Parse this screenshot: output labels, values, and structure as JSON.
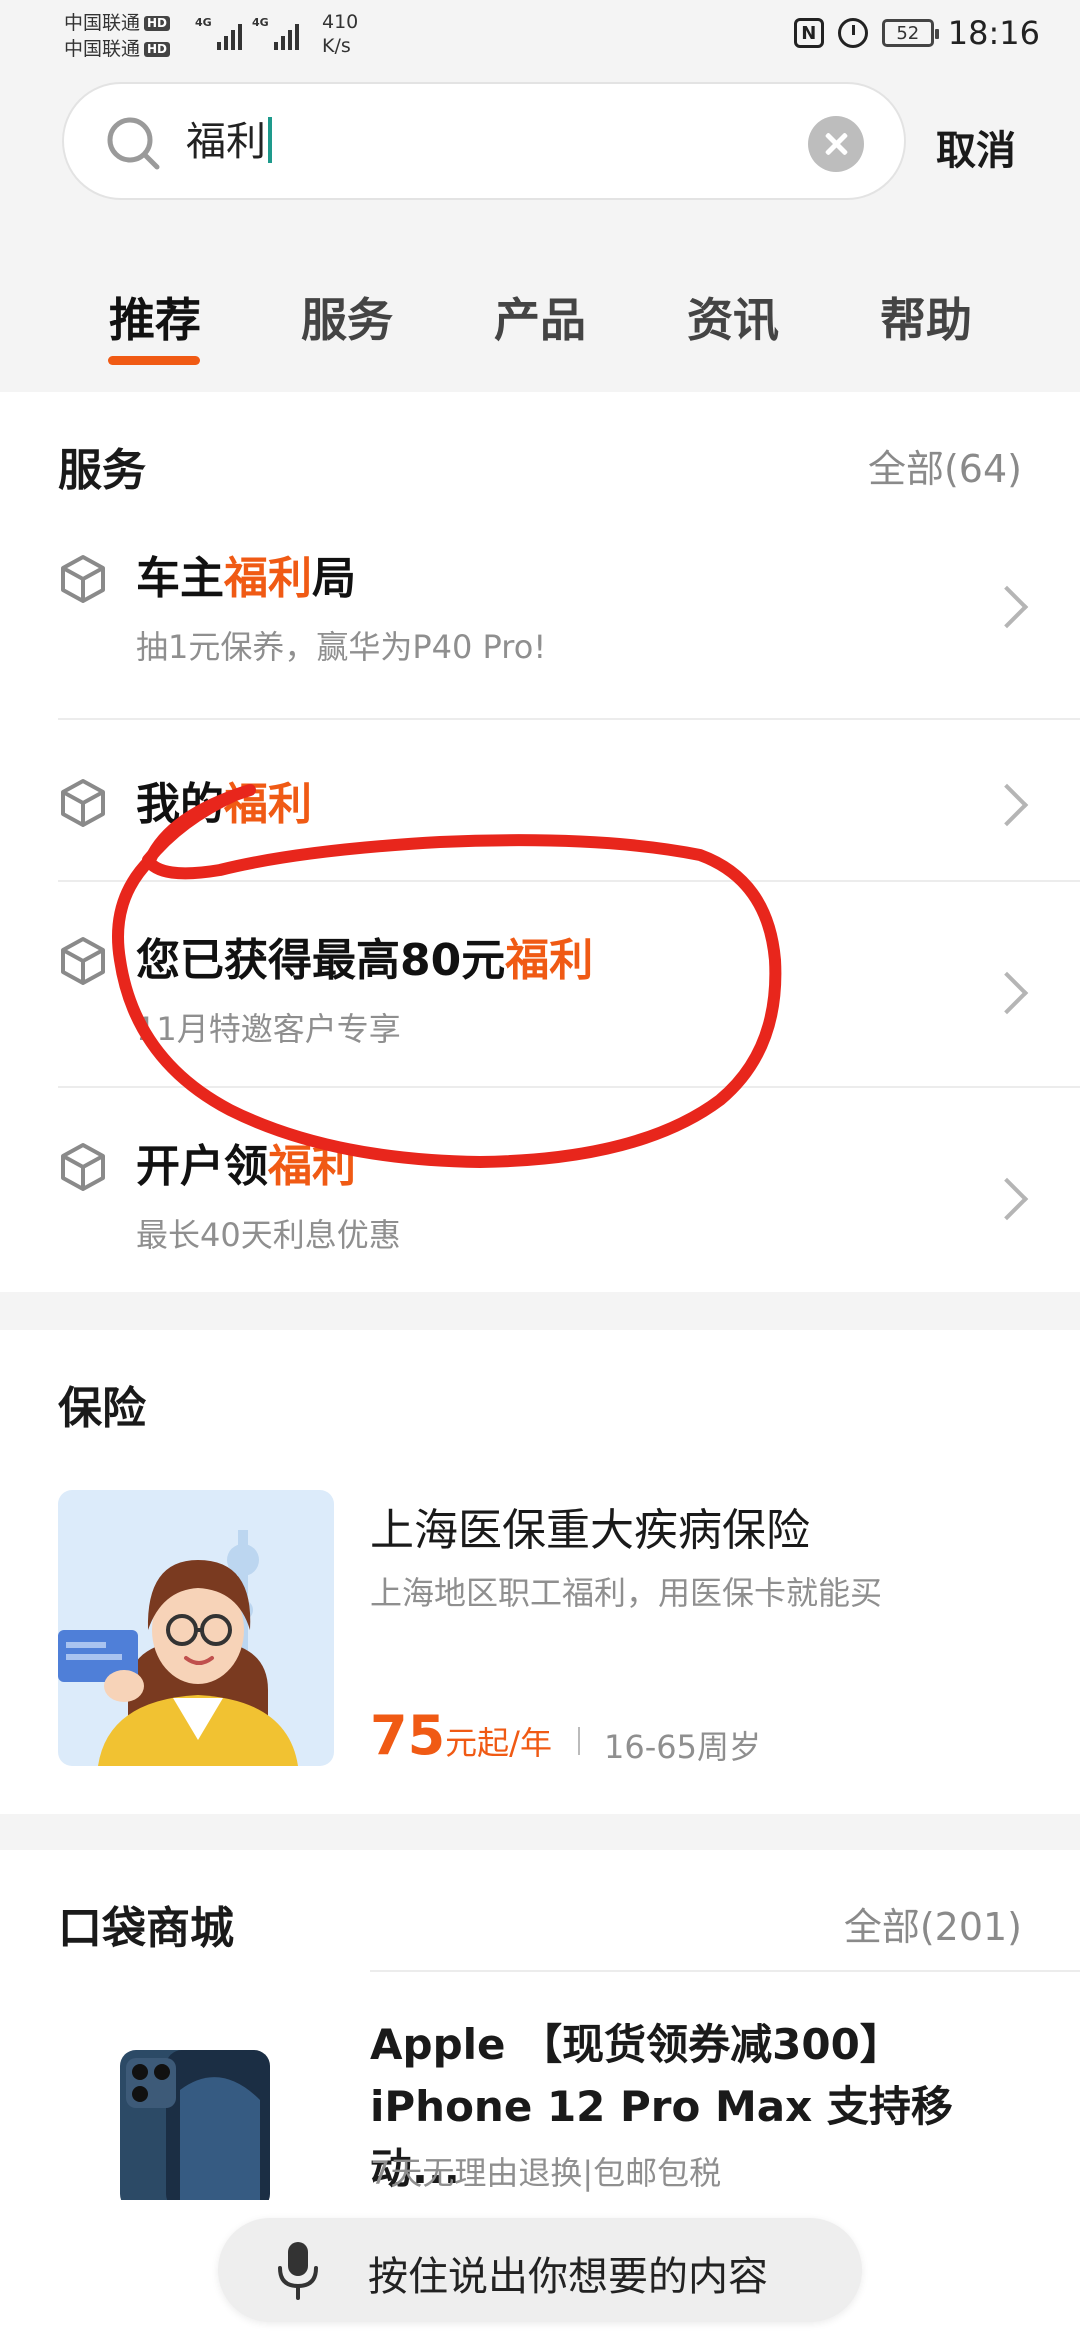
{
  "status_bar": {
    "carrier1": "中国联通",
    "carrier2": "中国联通",
    "hd": "HD",
    "network": "4G",
    "speed_value": "410",
    "speed_unit": "K/s",
    "nfc": "N",
    "battery": "52",
    "time": "18:16"
  },
  "search": {
    "value": "福利",
    "cancel_label": "取消"
  },
  "tabs": [
    {
      "label": "推荐",
      "active": true
    },
    {
      "label": "服务",
      "active": false
    },
    {
      "label": "产品",
      "active": false
    },
    {
      "label": "资讯",
      "active": false
    },
    {
      "label": "帮助",
      "active": false
    }
  ],
  "services": {
    "title": "服务",
    "more": "全部(64)",
    "items": [
      {
        "title_pre": "车主",
        "title_hl": "福利",
        "title_post": "局",
        "subtitle": "抽1元保养，赢华为P40 Pro!"
      },
      {
        "title_pre": "我的",
        "title_hl": "福利",
        "title_post": "",
        "subtitle": ""
      },
      {
        "title_pre": "您已获得最高80元",
        "title_hl": "福利",
        "title_post": "",
        "subtitle": "11月特邀客户专享"
      },
      {
        "title_pre": "开户领",
        "title_hl": "福利",
        "title_post": "",
        "subtitle": "最长40天利息优惠"
      }
    ]
  },
  "insurance": {
    "title": "保险",
    "product_title": "上海医保重大疾病保险",
    "product_desc": "上海地区职工福利，用医保卡就能买",
    "price_value": "75",
    "price_unit": "元起/年",
    "age_range": "16-65周岁"
  },
  "mall": {
    "title": "口袋商城",
    "more": "全部(201)",
    "product_title_line1": "Apple 【现货领券减300】",
    "product_title_line2": "iPhone 12 Pro Max 支持移动...",
    "product_tags": "7天无理由退换|包邮包税"
  },
  "voice": {
    "prompt": "按住说出你想要的内容"
  },
  "colors": {
    "accent": "#f05a14",
    "annotation": "#e8261c",
    "caret": "#1e9a8c"
  }
}
